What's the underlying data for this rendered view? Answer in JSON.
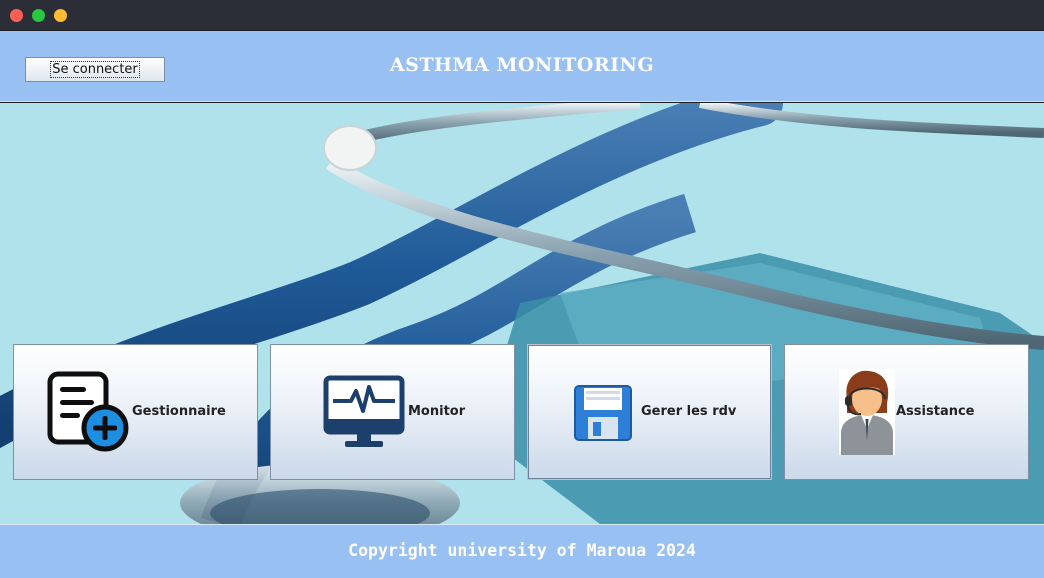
{
  "window": {
    "controls": [
      "close",
      "minimize",
      "maximize"
    ]
  },
  "header": {
    "connect_label": "Se connecter",
    "title": "ASTHMA MONITORING"
  },
  "menu": [
    {
      "label": "Gestionnaire",
      "icon": "document-add-icon"
    },
    {
      "label": "Monitor",
      "icon": "heartbeat-monitor-icon"
    },
    {
      "label": "Gerer les rdv",
      "icon": "floppy-disk-icon"
    },
    {
      "label": "Assistance",
      "icon": "support-agent-icon"
    }
  ],
  "footer": {
    "copyright": "Copyright university of Maroua 2024"
  },
  "colors": {
    "header_bg": "#98c0f3",
    "footer_bg": "#98c0f3",
    "hero_bg": "#9cdbe7"
  }
}
